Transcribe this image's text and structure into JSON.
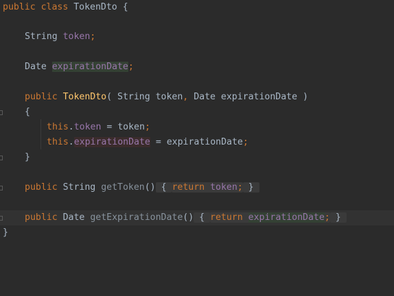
{
  "editor": {
    "lines": [
      {
        "kw": "public class",
        "name": "TokenDto",
        "open": "{"
      },
      {
        "type": "String",
        "field": "token",
        "semi": ";"
      },
      {
        "type": "Date",
        "field": "expirationDate",
        "semi": ";"
      },
      {
        "kw": "public",
        "name": "TokenDto",
        "params_open": "( String token",
        "comma": ",",
        "params_rest": "Date expirationDate )"
      },
      {
        "text": "{"
      },
      {
        "kw": "this",
        "dot": ".",
        "field": "token",
        "assign": " = token",
        "semi": ";"
      },
      {
        "kw": "this",
        "dot": ".",
        "field": "expirationDate",
        "assign": " = expirationDate",
        "semi": ";"
      },
      {
        "text": "}"
      },
      {
        "kw": "public",
        "type": "String",
        "name": "getToken",
        "parens": "()",
        "open": "{",
        "ret": "return",
        "field": "token",
        "semi": ";",
        "close": "}"
      },
      {
        "kw": "public",
        "type": "Date",
        "name": "getExpirationDate",
        "parens": "()",
        "open": "{",
        "ret": "return",
        "field": "expirationDate",
        "semi": ";",
        "close": "}"
      },
      {
        "text": "}"
      }
    ]
  },
  "colors": {
    "background": "#2b2b2b",
    "keyword": "#cc7832",
    "field": "#9876aa",
    "method": "#ffc66d",
    "text": "#a9b7c6",
    "current_line": "#323232"
  }
}
